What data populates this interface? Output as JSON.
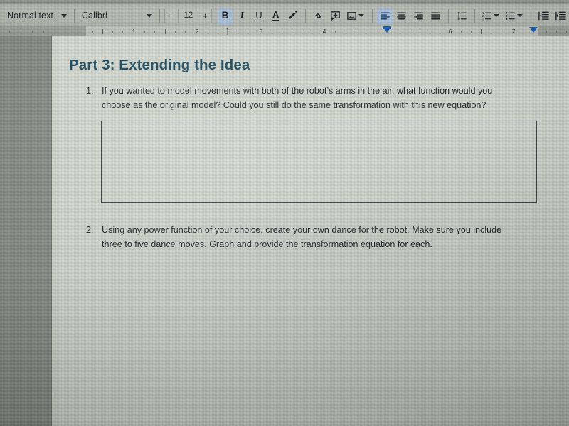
{
  "app": {
    "name": "google-docs",
    "window_title": "Google Docs document"
  },
  "toolbar": {
    "style_dropdown": {
      "label": "Normal text",
      "icon": "chevron-down-icon"
    },
    "font_dropdown": {
      "label": "Calibri",
      "icon": "chevron-down-icon"
    },
    "font_size": {
      "decrease_label": "−",
      "value": "12",
      "increase_label": "+"
    },
    "buttons": [
      {
        "name": "bold",
        "label": "B",
        "active": true
      },
      {
        "name": "italic",
        "label": "I",
        "active": false
      },
      {
        "name": "underline",
        "label": "U",
        "active": false
      },
      {
        "name": "text-color",
        "label": "A",
        "active": false
      },
      {
        "name": "highlight-color",
        "label": "",
        "active": false
      },
      {
        "name": "insert-link",
        "label": "",
        "active": false
      },
      {
        "name": "add-comment",
        "label": "",
        "active": false
      },
      {
        "name": "insert-image",
        "label": "",
        "active": false
      },
      {
        "name": "align-left",
        "label": "",
        "active": true
      },
      {
        "name": "align-center",
        "label": "",
        "active": false
      },
      {
        "name": "align-right",
        "label": "",
        "active": false
      },
      {
        "name": "align-justify",
        "label": "",
        "active": false
      },
      {
        "name": "line-spacing",
        "label": "",
        "active": false
      },
      {
        "name": "numbered-list",
        "label": "",
        "active": false
      },
      {
        "name": "bulleted-list",
        "label": "",
        "active": false
      },
      {
        "name": "decrease-indent",
        "label": "",
        "active": false
      },
      {
        "name": "increase-indent",
        "label": "",
        "active": false
      }
    ],
    "accent_color": "#b3c8e6"
  },
  "ruler": {
    "numbers": [
      "1",
      "2",
      "3",
      "4",
      "6",
      "7"
    ],
    "indent_marker_color": "#1a5fb4"
  },
  "document": {
    "heading": "Part 3: Extending the Idea",
    "heading_color": "#1d4e63",
    "questions": [
      {
        "number": "1.",
        "line1": "If you wanted to model movements with both of the robot’s arms in the air, what function would you",
        "line2": "choose as the original model? Could you still do the same transformation with this new equation?"
      },
      {
        "number": "2.",
        "line1": "Using any power function of your choice, create your own dance for the robot. Make sure you include",
        "line2": "three to five dance moves. Graph and provide the transformation equation for each."
      }
    ],
    "answer_box": {
      "name": "answer-box",
      "border_color": "#3c4148"
    }
  }
}
